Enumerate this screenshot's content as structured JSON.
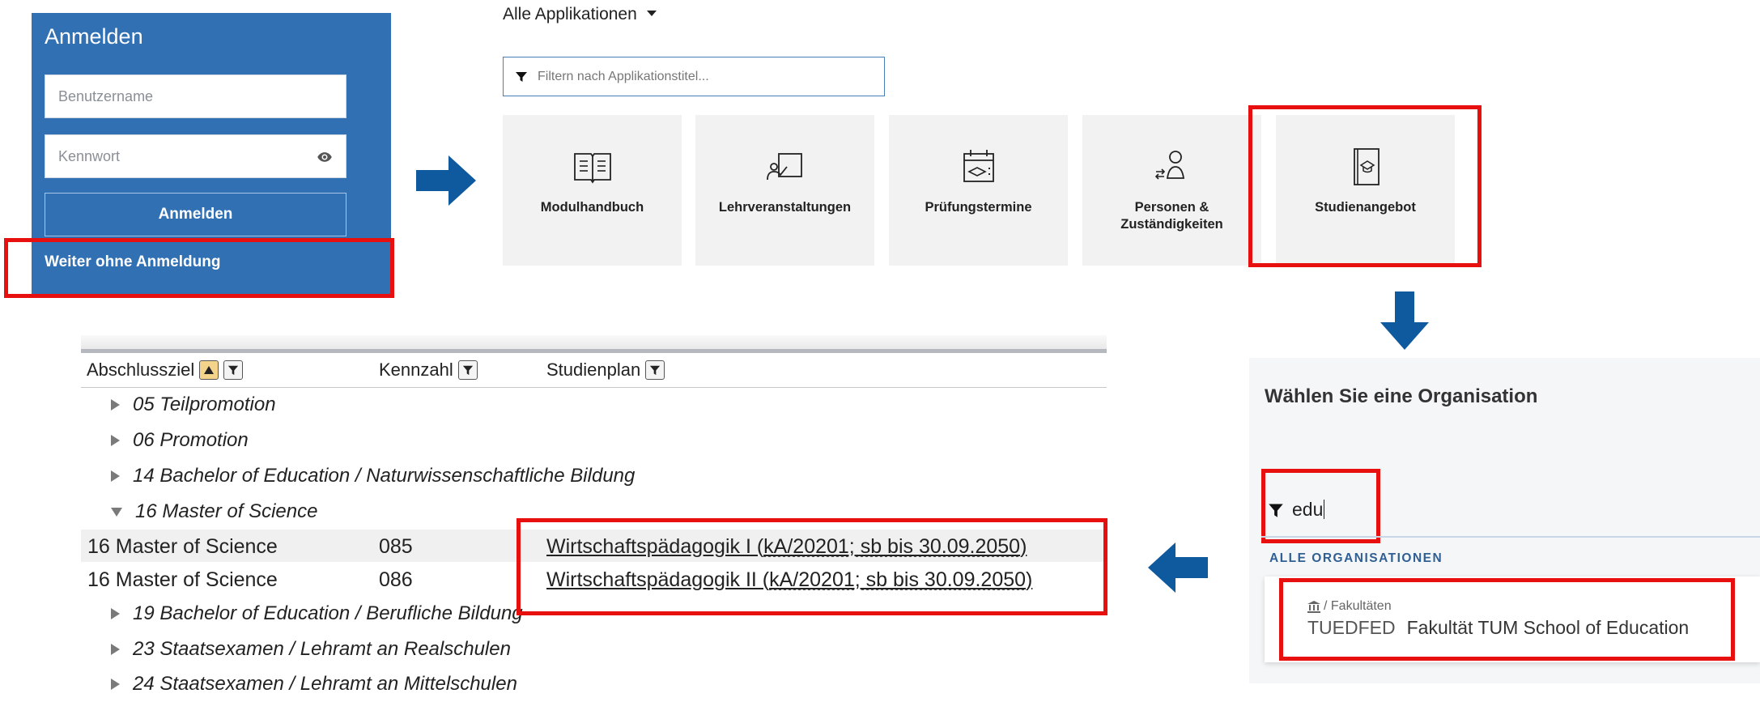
{
  "login": {
    "title": "Anmelden",
    "username_placeholder": "Benutzername",
    "password_placeholder": "Kennwort",
    "submit_label": "Anmelden",
    "guest_link": "Weiter ohne Anmeldung"
  },
  "apps": {
    "title": "Alle Applikationen",
    "filter_placeholder": "Filtern nach Applikationstitel...",
    "tiles": [
      {
        "label": "Modulhandbuch",
        "icon": "book-icon"
      },
      {
        "label": "Lehrveranstaltungen",
        "icon": "lecture-icon"
      },
      {
        "label": "Prüfungstermine",
        "icon": "exam-calendar-icon"
      },
      {
        "label": "Personen & Zuständigkeiten",
        "icon": "persons-icon"
      },
      {
        "label": "Studienangebot",
        "icon": "study-program-icon"
      }
    ]
  },
  "organisation": {
    "title": "Wählen Sie eine Organisation",
    "filter_value": "edu",
    "section_header": "ALLE ORGANISATIONEN",
    "result": {
      "type": "/ Fakultäten",
      "code": "TUEDFED",
      "name": "Fakultät TUM School of Education"
    }
  },
  "table": {
    "columns": [
      "Abschlussziel",
      "Kennzahl",
      "Studienplan"
    ],
    "rows_before": [
      {
        "label": "05 Teilpromotion",
        "expanded": false
      },
      {
        "label": "06 Promotion",
        "expanded": false
      },
      {
        "label": "14 Bachelor of Education / Naturwissenschaftliche Bildung",
        "expanded": false
      },
      {
        "label": "16 Master of Science",
        "expanded": true
      }
    ],
    "data_rows": [
      {
        "abschluss": "16 Master of Science",
        "kennzahl": "085",
        "plan_main": "Wirtschaftspädagogik I (",
        "plan_code": "kA/20201; sb bis 30.09.2050",
        "plan_end": ")"
      },
      {
        "abschluss": "16 Master of Science",
        "kennzahl": "086",
        "plan_main": "Wirtschaftspädagogik II (",
        "plan_code": "kA/20201; sb bis 30.09.2050",
        "plan_end": ")"
      }
    ],
    "rows_after": [
      {
        "label": "19 Bachelor of Education / Berufliche Bildung",
        "expanded": false
      },
      {
        "label": "23 Staatsexamen / Lehramt an Realschulen",
        "expanded": false
      },
      {
        "label": "24 Staatsexamen / Lehramt an Mittelschulen",
        "expanded": false
      }
    ]
  },
  "colors": {
    "brand_blue": "#3070b3",
    "arrow_blue": "#0f5a9e",
    "highlight_red": "#e8100f"
  }
}
